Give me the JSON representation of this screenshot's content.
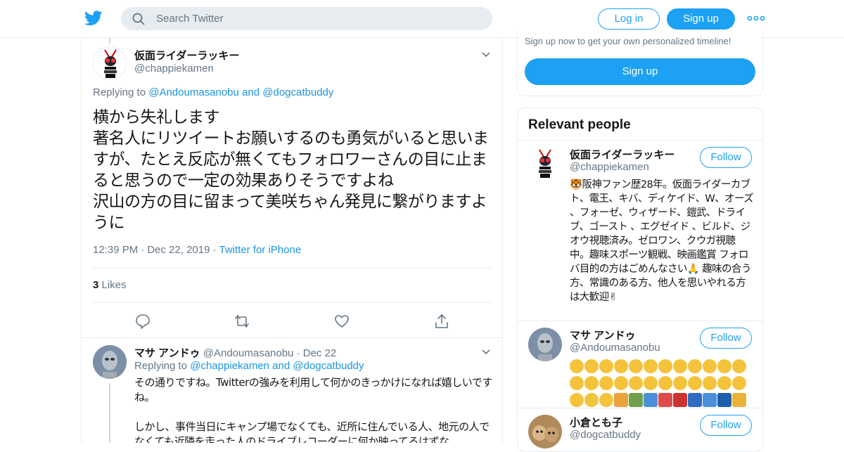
{
  "topbar": {
    "search_placeholder": "Search Twitter",
    "login_label": "Log in",
    "signup_label": "Sign up",
    "accent": "#1da1f2"
  },
  "tweet": {
    "name": "仮面ライダーラッキー",
    "handle": "@chappiekamen",
    "replying_prefix": "Replying to ",
    "replying_to_1": "@Andoumasanobu",
    "replying_and": " and ",
    "replying_to_2": "@dogcatbuddy",
    "text": "横から失礼します\n著名人にリツイートお願いするのも勇気がいると思いますが、たとえ反応が無くてもフォロワーさんの目に止まると思うので一定の効果ありそうですよね\n沢山の方の目に留まって美咲ちゃん発見に繋がりますように",
    "time": "12:39 PM",
    "date": "Dec 22, 2019",
    "source": "Twitter for iPhone",
    "likes_count": "3",
    "likes_label": " Likes",
    "dot": "·"
  },
  "reply": {
    "name": "マサ アンドゥ",
    "handle": "@Andoumasanobu",
    "date": "Dec 22",
    "dot": "·",
    "replying_prefix": "Replying to ",
    "replying_to_1": "@chappiekamen",
    "replying_and": " and ",
    "replying_to_2": "@dogcatbuddy",
    "text": "その通りですね。Twitterの強みを利用して何かのきっかけになれば嬉しいですね。\n\nしかし、事件当日にキャンプ場でなくても、近所に住んでいる人、地元の人でなくても近隣を走った人のドライブレコーダーに何か映ってるはずな"
  },
  "sidebar": {
    "signup_text": "Sign up now to get your own personalized timeline!",
    "signup_button": "Sign up",
    "relevant_title": "Relevant people",
    "people": [
      {
        "name": "仮面ライダーラッキー",
        "handle": "@chappiekamen",
        "follow_label": "Follow",
        "bio": "🐯阪神ファン歴28年。仮面ライダーカブト、電王、キバ、ディケイド、W、オーズ 、フォーゼ、ウィザード、鎧武、ドライブ、ゴースト 、エグゼイド 、ビルド、ジオウ視聴済み。ゼロワン、クウガ視聴中。趣味スポーツ観戦、映画鑑賞 フォロバ目的の方はごめんなさい🙏 趣味の合う方、常識のある方、他人を思いやれる方は大歓迎✌"
      },
      {
        "name": "マサ アンドゥ",
        "handle": "@Andoumasanobu",
        "follow_label": "Follow",
        "bio_icon": "emoji-row-icon"
      },
      {
        "name": "小倉とも子",
        "handle": "@dogcatbuddy",
        "follow_label": "Follow"
      }
    ]
  }
}
